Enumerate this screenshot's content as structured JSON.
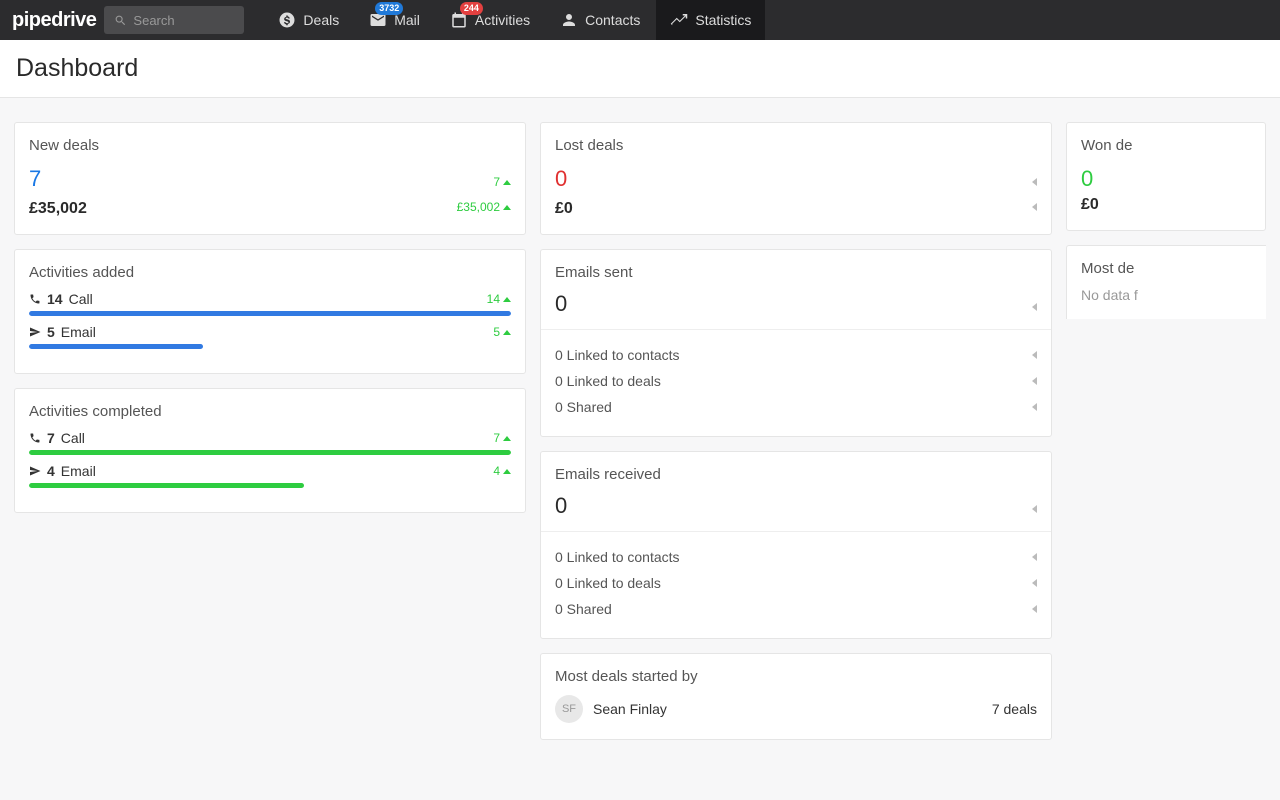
{
  "header": {
    "logo": "pipedrive",
    "search_placeholder": "Search",
    "nav": {
      "deals": "Deals",
      "mail": "Mail",
      "mail_badge": "3732",
      "activities": "Activities",
      "activities_badge": "244",
      "contacts": "Contacts",
      "statistics": "Statistics"
    }
  },
  "page": {
    "title": "Dashboard"
  },
  "cards": {
    "new_deals": {
      "title": "New deals",
      "count": "7",
      "amount": "£35,002",
      "trend_count": "7",
      "trend_amount": "£35,002"
    },
    "lost_deals": {
      "title": "Lost deals",
      "count": "0",
      "amount": "£0"
    },
    "won_deals": {
      "title_truncated": "Won de",
      "count": "0",
      "amount": "£0"
    },
    "activities_added": {
      "title": "Activities added",
      "items": [
        {
          "count": "14",
          "label": "Call",
          "trend": "14",
          "fill_pct": 100
        },
        {
          "count": "5",
          "label": "Email",
          "trend": "5",
          "fill_pct": 36
        }
      ]
    },
    "activities_completed": {
      "title": "Activities completed",
      "items": [
        {
          "count": "7",
          "label": "Call",
          "trend": "7",
          "fill_pct": 100
        },
        {
          "count": "4",
          "label": "Email",
          "trend": "4",
          "fill_pct": 57
        }
      ]
    },
    "emails_sent": {
      "title": "Emails sent",
      "count": "0",
      "rows": [
        {
          "label": "0 Linked to contacts"
        },
        {
          "label": "0 Linked to deals"
        },
        {
          "label": "0 Shared"
        }
      ]
    },
    "emails_received": {
      "title": "Emails received",
      "count": "0",
      "rows": [
        {
          "label": "0 Linked to contacts"
        },
        {
          "label": "0 Linked to deals"
        },
        {
          "label": "0 Shared"
        }
      ]
    },
    "most_deals_started": {
      "title": "Most deals started by",
      "avatar": "SF",
      "name": "Sean Finlay",
      "deals": "7 deals"
    },
    "most_deals_cut": {
      "title_truncated": "Most de",
      "no_data": "No data f"
    }
  }
}
